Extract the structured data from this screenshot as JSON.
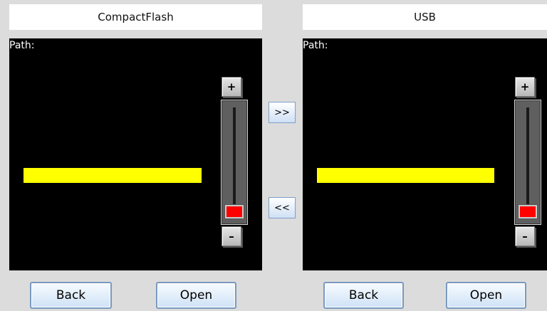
{
  "left_panel": {
    "title": "CompactFlash",
    "path_label": "Path:",
    "scroll_up": "+",
    "scroll_down": "–",
    "back_label": "Back",
    "open_label": "Open"
  },
  "right_panel": {
    "title": "USB",
    "path_label": "Path:",
    "scroll_up": "+",
    "scroll_down": "–",
    "back_label": "Back",
    "open_label": "Open"
  },
  "transfer": {
    "copy_right_label": ">>",
    "copy_left_label": "<<"
  },
  "colors": {
    "selection_highlight": "#ffff00",
    "scroll_thumb": "#ff0000",
    "screen_background": "#000000"
  }
}
